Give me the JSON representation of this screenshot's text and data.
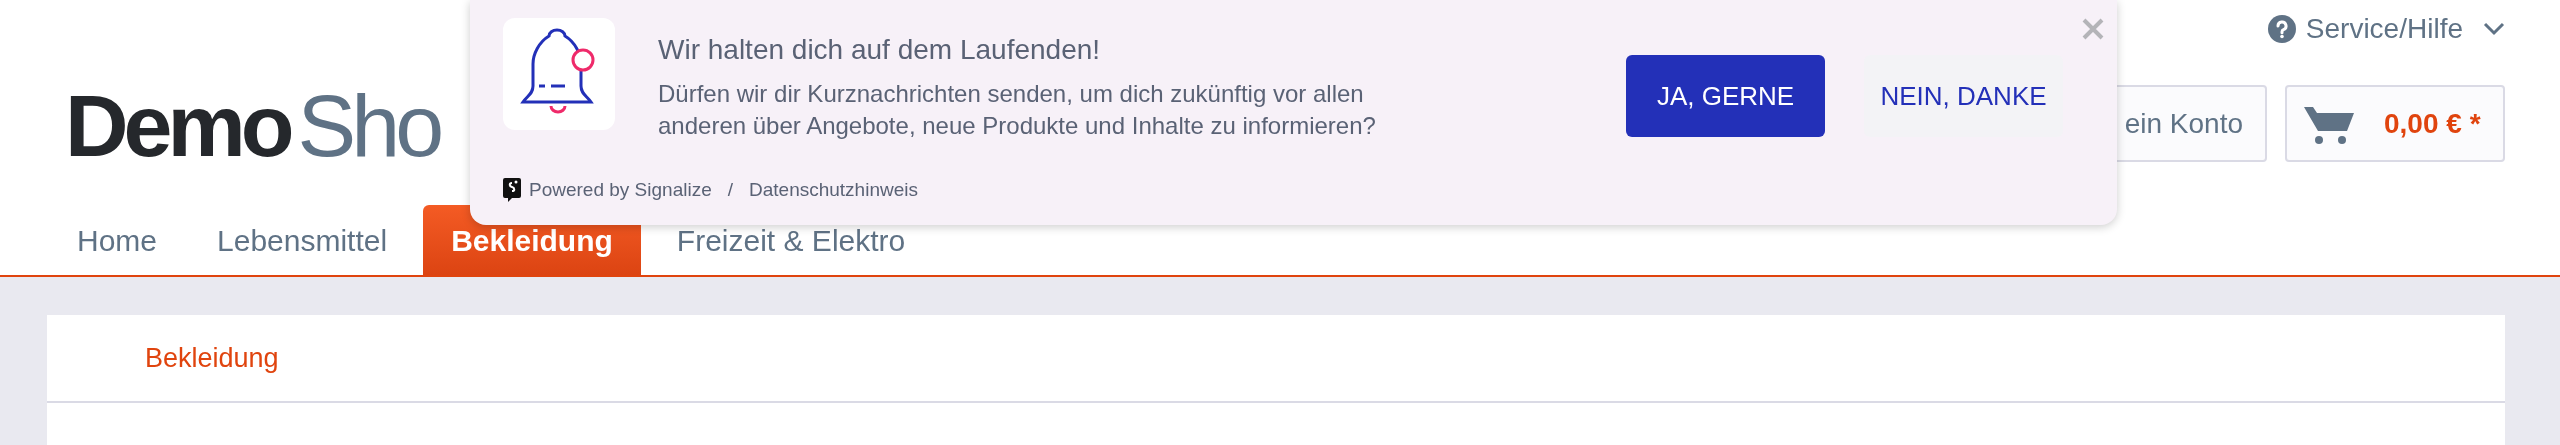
{
  "header": {
    "service_menu": {
      "label": "Service/Hilfe"
    },
    "logo": {
      "brand": "Demo",
      "visible_text": "Sho"
    },
    "account_button": {
      "label": "ein Konto"
    },
    "cart_button": {
      "total": "0,00 € *"
    }
  },
  "nav": {
    "items": [
      {
        "label": "Home",
        "selected": false
      },
      {
        "label": "Lebensmittel",
        "selected": false
      },
      {
        "label": "Bekleidung",
        "selected": true
      },
      {
        "label": "Freizeit & Elektro",
        "selected": false
      }
    ]
  },
  "breadcrumb": [
    "Bekleidung"
  ],
  "push_prompt": {
    "title": "Wir halten dich auf dem Laufenden!",
    "message_lines": [
      "Dürfen wir dir Kurznachrichten senden, um dich zukünftig vor allen",
      "anderen über Angebote, neue Produkte und Inhalte zu informieren?"
    ],
    "powered_by": "Powered by Signalize",
    "separator": "/",
    "privacy_link": "Datenschutzhinweis",
    "accept_button": "JA, GERNE",
    "decline_button": "NEIN, DANKE"
  }
}
